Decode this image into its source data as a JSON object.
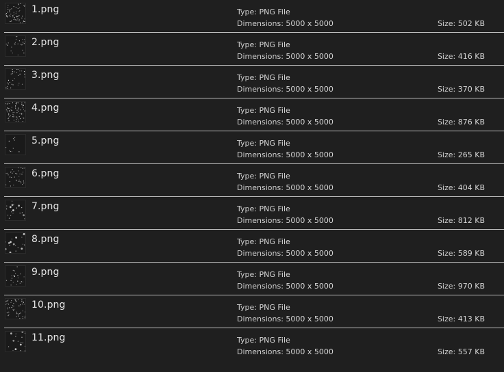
{
  "files": [
    {
      "name": "1.png",
      "type_label": "Type:",
      "type": "PNG File",
      "dims_label": "Dimensions:",
      "dims": "5000 x 5000",
      "size_label": "Size:",
      "size": "502 KB",
      "thumb_icon": "texture-noise-icon"
    },
    {
      "name": "2.png",
      "type_label": "Type:",
      "type": "PNG File",
      "dims_label": "Dimensions:",
      "dims": "5000 x 5000",
      "size_label": "Size:",
      "size": "416 KB",
      "thumb_icon": "texture-noise-icon"
    },
    {
      "name": "3.png",
      "type_label": "Type:",
      "type": "PNG File",
      "dims_label": "Dimensions:",
      "dims": "5000 x 5000",
      "size_label": "Size:",
      "size": "370 KB",
      "thumb_icon": "texture-noise-icon"
    },
    {
      "name": "4.png",
      "type_label": "Type:",
      "type": "PNG File",
      "dims_label": "Dimensions:",
      "dims": "5000 x 5000",
      "size_label": "Size:",
      "size": "876 KB",
      "thumb_icon": "texture-noise-icon"
    },
    {
      "name": "5.png",
      "type_label": "Type:",
      "type": "PNG File",
      "dims_label": "Dimensions:",
      "dims": "5000 x 5000",
      "size_label": "Size:",
      "size": "265 KB",
      "thumb_icon": "texture-noise-icon"
    },
    {
      "name": "6.png",
      "type_label": "Type:",
      "type": "PNG File",
      "dims_label": "Dimensions:",
      "dims": "5000 x 5000",
      "size_label": "Size:",
      "size": "404 KB",
      "thumb_icon": "texture-noise-icon"
    },
    {
      "name": "7.png",
      "type_label": "Type:",
      "type": "PNG File",
      "dims_label": "Dimensions:",
      "dims": "5000 x 5000",
      "size_label": "Size:",
      "size": "812 KB",
      "thumb_icon": "snowflake-icon"
    },
    {
      "name": "8.png",
      "type_label": "Type:",
      "type": "PNG File",
      "dims_label": "Dimensions:",
      "dims": "5000 x 5000",
      "size_label": "Size:",
      "size": "589 KB",
      "thumb_icon": "sparkle-icon"
    },
    {
      "name": "9.png",
      "type_label": "Type:",
      "type": "PNG File",
      "dims_label": "Dimensions:",
      "dims": "5000 x 5000",
      "size_label": "Size:",
      "size": "970 KB",
      "thumb_icon": "sparkle-icon"
    },
    {
      "name": "10.png",
      "type_label": "Type:",
      "type": "PNG File",
      "dims_label": "Dimensions:",
      "dims": "5000 x 5000",
      "size_label": "Size:",
      "size": "413 KB",
      "thumb_icon": "texture-noise-icon"
    },
    {
      "name": "11.png",
      "type_label": "Type:",
      "type": "PNG File",
      "dims_label": "Dimensions:",
      "dims": "5000 x 5000",
      "size_label": "Size:",
      "size": "557 KB",
      "thumb_icon": "sparkle-icon"
    }
  ],
  "colors": {
    "background": "#1f1f1f",
    "divider": "#bdbdbd",
    "text": "#e6e6e6"
  }
}
